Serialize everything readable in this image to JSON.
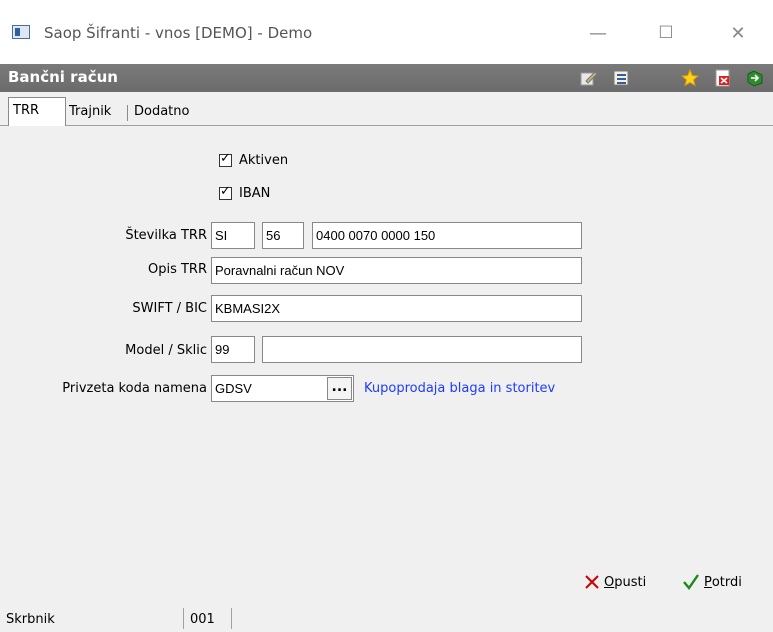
{
  "window": {
    "title": "Saop Šifranti - vnos [DEMO] - Demo",
    "minimize": "—",
    "maximize": "☐",
    "close": "✕"
  },
  "header": {
    "title": "Bančni račun",
    "toolbar_icons": [
      "edit-icon",
      "list-icon",
      "star-icon",
      "delete-icon",
      "exit-icon"
    ]
  },
  "tabs": [
    {
      "label": "TRR",
      "active": true
    },
    {
      "label": "Trajnik",
      "active": false
    },
    {
      "label": "Dodatno",
      "active": false
    }
  ],
  "form": {
    "aktiven": {
      "label": "Aktiven",
      "checked": true
    },
    "iban": {
      "label": "IBAN",
      "checked": true
    },
    "stevilka_trr": {
      "label": "Številka TRR",
      "country": "SI",
      "check": "56",
      "number": "0400 0070 0000 150"
    },
    "opis_trr": {
      "label": "Opis TRR",
      "value": "Poravnalni račun NOV"
    },
    "swift": {
      "label": "SWIFT / BIC",
      "value": "KBMASI2X"
    },
    "model_sklic": {
      "label": "Model / Sklic",
      "model": "99",
      "sklic": ""
    },
    "koda_namena": {
      "label": "Privzeta koda namena",
      "value": "GDSV",
      "lookup": "...",
      "description": "Kupoprodaja blaga in storitev"
    }
  },
  "actions": {
    "cancel": {
      "mnemonic": "O",
      "rest": "pusti"
    },
    "confirm": {
      "mnemonic": "P",
      "rest": "otrdi"
    }
  },
  "status": {
    "label": "Skrbnik",
    "value": "001"
  },
  "colors": {
    "header_bg": "#727272",
    "link": "#1e3cff",
    "cancel_icon": "#cc0000",
    "confirm_icon": "#1a8a1a"
  }
}
